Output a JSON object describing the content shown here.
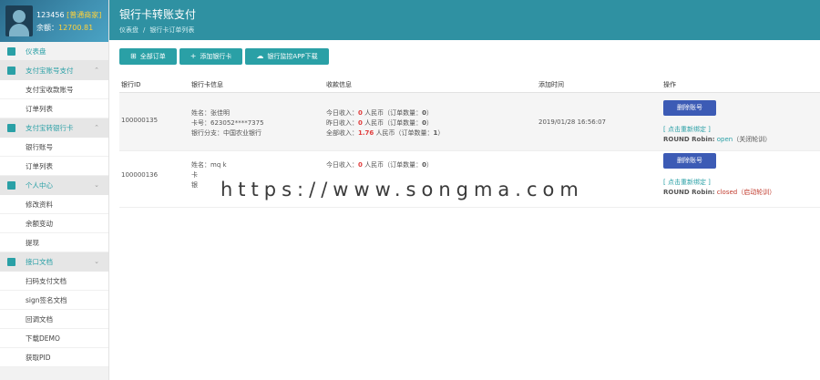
{
  "profile": {
    "username": "123456",
    "badge": "[普通商家]",
    "balance_label": "余额：",
    "balance": "12700.81"
  },
  "sidebar": {
    "items": [
      {
        "label": "仪表盘",
        "type": "top",
        "icon": "dashboard-icon"
      },
      {
        "label": "支付宝账号支付",
        "type": "section",
        "icon": "alipay-icon"
      },
      {
        "label": "支付宝收款账号",
        "type": "sub"
      },
      {
        "label": "订单列表",
        "type": "sub"
      },
      {
        "label": "支付宝转银行卡",
        "type": "section",
        "icon": "bank-icon"
      },
      {
        "label": "银行账号",
        "type": "sub"
      },
      {
        "label": "订单列表",
        "type": "sub"
      },
      {
        "label": "个人中心",
        "type": "section",
        "icon": "user-icon"
      },
      {
        "label": "修改资料",
        "type": "sub"
      },
      {
        "label": "余额变动",
        "type": "sub"
      },
      {
        "label": "提现",
        "type": "sub"
      },
      {
        "label": "接口文档",
        "type": "section",
        "icon": "doc-icon"
      },
      {
        "label": "扫码支付文档",
        "type": "sub"
      },
      {
        "label": "sign签名文档",
        "type": "sub"
      },
      {
        "label": "回调文档",
        "type": "sub"
      },
      {
        "label": "下载DEMO",
        "type": "sub"
      },
      {
        "label": "获取PID",
        "type": "sub"
      }
    ]
  },
  "header": {
    "title": "银行卡转账支付",
    "breadcrumb": [
      "仪表盘",
      "银行卡订单列表"
    ]
  },
  "toolbar": {
    "all_orders": "全部订单",
    "add_card": "添加银行卡",
    "download_app": "银行监控APP下载"
  },
  "table": {
    "headers": [
      "银行ID",
      "银行卡信息",
      "收款信息",
      "添加时间",
      "操作"
    ],
    "rows": [
      {
        "id": "100000135",
        "name": "姓名：张佳明",
        "card": "卡号：623052****7375",
        "bank": "银行分支：中国农业银行",
        "today_prefix": "今日收入：",
        "today_amount": "0",
        "today_suffix": " 人民币（订单数量：",
        "today_count": "0",
        "today_end": "）",
        "yest_prefix": "昨日收入：",
        "yest_amount": "0",
        "yest_suffix": " 人民币（订单数量：",
        "yest_count": "0",
        "yest_end": "）",
        "all_prefix": "全部收入：",
        "all_amount": "1.76",
        "all_suffix": " 人民币（订单数量：",
        "all_count": "1",
        "all_end": "）",
        "added": "2019/01/28 16:56:07",
        "delete": "删除账号",
        "rebind": "[ 点击重新绑定 ]",
        "rr_label": "ROUND Robin:",
        "rr_status": "open",
        "rr_action": "（关闭轮训）"
      },
      {
        "id": "100000136",
        "name": "姓名：mq k",
        "card": "卡",
        "bank": "银",
        "today_prefix": "今日收入：",
        "today_amount": "0",
        "today_suffix": " 人民币（订单数量：",
        "today_count": "0",
        "today_end": "）",
        "added": "",
        "delete": "删除账号",
        "rebind": "[ 点击重新绑定 ]",
        "rr_label": "ROUND Robin:",
        "rr_status": "closed",
        "rr_action": "（启动轮训）"
      }
    ]
  },
  "watermark": "https://www.songma.com"
}
